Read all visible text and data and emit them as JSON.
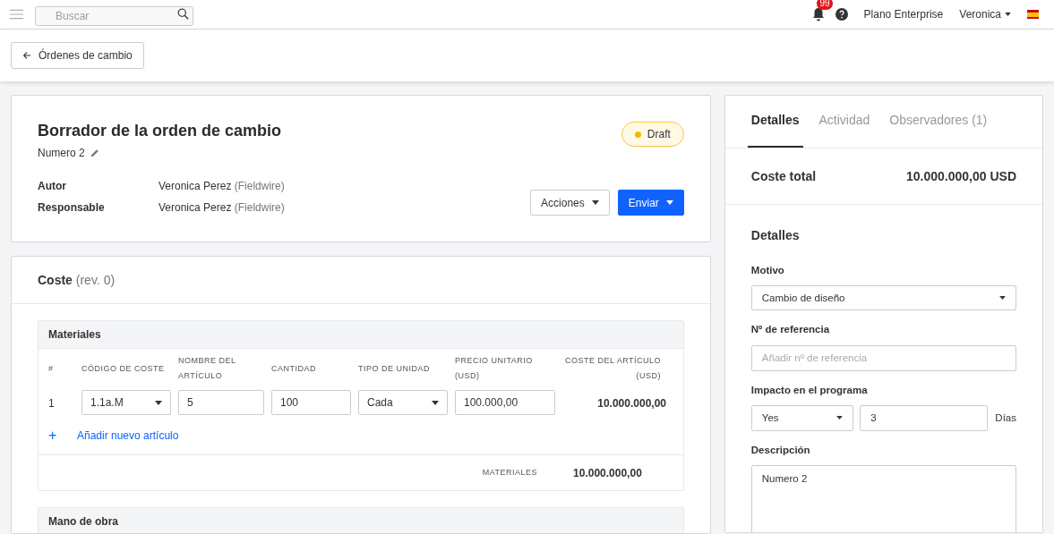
{
  "top_bar": {
    "search": {
      "placeholder": "Buscar"
    },
    "notification_count": "99",
    "plan": "Plano Enterprise",
    "user": "Veronica"
  },
  "back_button": "Órdenes de cambio",
  "header": {
    "title": "Borrador de la orden de cambio",
    "number": "Numero 2",
    "status": "Draft",
    "fields": [
      {
        "label": "Autor",
        "value": "Veronica Perez",
        "org": "(Fieldwire)"
      },
      {
        "label": "Responsable",
        "value": "Veronica Perez",
        "org": "(Fieldwire)"
      }
    ],
    "buttons": [
      {
        "label": "Acciones",
        "kind": "secondary"
      },
      {
        "label": "Enviar",
        "kind": "primary"
      }
    ]
  },
  "cost": {
    "title": "Coste",
    "revision": "(rev. 0)",
    "sections": [
      {
        "title": "Materiales",
        "columns": [
          "#",
          "CÓDIGO DE COSTE",
          "NOMBRE DEL ARTÍCULO",
          "CANTIDAD",
          "TIPO DE UNIDAD",
          "PRECIO UNITARIO (USD)",
          "COSTE DEL ARTÍCULO (USD)"
        ],
        "rows": [
          {
            "cells": [
              {
                "kind": "text",
                "value": "1"
              },
              {
                "kind": "select",
                "value": "1.1a.M"
              },
              {
                "kind": "input",
                "value": "5"
              },
              {
                "kind": "input",
                "value": "100"
              },
              {
                "kind": "select",
                "value": "Cada"
              },
              {
                "kind": "input",
                "value": "100.000,00"
              },
              {
                "kind": "total",
                "value": "10.000.000,00"
              }
            ]
          }
        ],
        "add_icon": "+",
        "add_label": "Añadir nuevo artículo",
        "subtotal_label": "MATERIALES",
        "subtotal": "10.000.000,00"
      },
      {
        "title": "Mano de obra"
      }
    ]
  },
  "side": {
    "tabs": [
      {
        "label": "Detalles",
        "selected": true
      },
      {
        "label": "Actividad",
        "selected": false
      },
      {
        "label": "Observadores (1)",
        "selected": false
      }
    ],
    "total_label": "Coste total",
    "total_value": "10.000.000,00 USD",
    "details_title": "Detalles",
    "fields": [
      {
        "kind": "select",
        "label": "Motivo",
        "value": "Cambio de diseño"
      },
      {
        "kind": "input",
        "label": "Nº de referencia",
        "placeholder": "Añadir nº de referencia"
      },
      {
        "kind": "impact",
        "label": "Impacto en el programa",
        "value": "Yes",
        "days": "3",
        "unit": "Días"
      },
      {
        "kind": "textarea",
        "label": "Descripción",
        "value": "Numero 2"
      }
    ]
  }
}
